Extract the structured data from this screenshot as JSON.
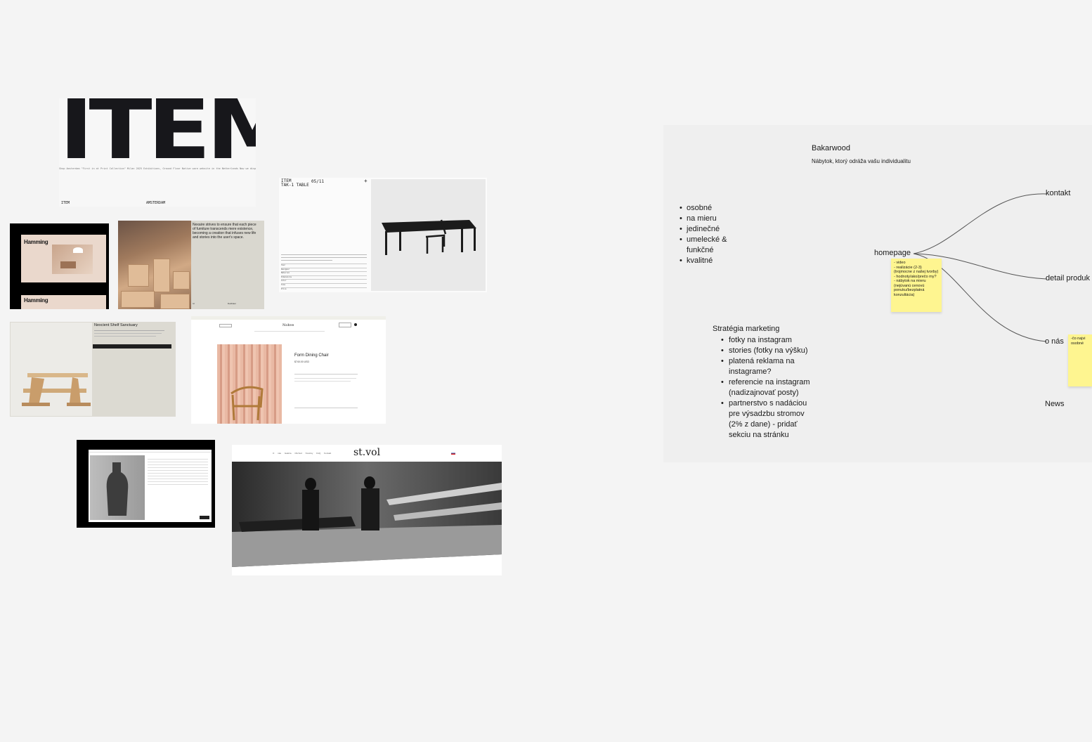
{
  "item_card": {
    "logo": "ITEM",
    "strip": "Shop Amsterdam     \"First in at Print Collection\" Milan 2025 Exhibitions, Ground Floor     Native ware website in the Netherlands     Now we display as sea Sheetroom by Eastwest Me",
    "footer_left": "ITEM",
    "footer_right": "AMSTERDAM"
  },
  "hamming": {
    "title_top": "Hamming",
    "title_bottom": "Hamming"
  },
  "wood_card": {
    "text": "Nexaire strives to ensure that each piece of furniture transcends mere existence, becoming a creation that infuses new life and stories into the user's space.",
    "footer_left": "Id",
    "footer_right": "Dekhaler"
  },
  "table_card": {
    "head": "ITEM\nTAK-1 TABLE",
    "number": "05/11",
    "plus": "+",
    "specs": [
      "Year",
      "Designer",
      "Material",
      "Dimensions",
      "Color",
      "Size",
      "Price"
    ]
  },
  "shelf_card": {
    "title": "Nexcient Shelf Sanctuary"
  },
  "chair_card": {
    "brand": "Nohve",
    "name": "Form Dining Chair",
    "price": "$740.00 USD"
  },
  "stvol_card": {
    "logo": "st.vol",
    "nav": "O nás Galéria Obchod Novinky FAQ Kontakt"
  },
  "mindmap": {
    "title": "Bakarwood",
    "subtitle": "Nábytok, ktorý odráža vašu individualitu",
    "bullets": [
      "osobné",
      "na mieru",
      "jedinečné",
      "umelecké & funkčné",
      "kvalitné"
    ],
    "strategy_title": "Stratégia marketing",
    "strategy": [
      "fotky na instagram",
      "stories (fotky na výšku)",
      "platená reklama na instagrame?",
      "referencie na instagram (nadizajnovať posty)",
      "partnerstvo s nadáciou pre výsadzbu stromov (2% z dane) - pridať sekciu na stránku"
    ],
    "nodes": {
      "homepage": "homepage",
      "kontakt": "kontakt",
      "detail": "detail produk",
      "onas": "o nás",
      "news": "News"
    },
    "sticky_home": "- video\n- realizácie (2-3) (trojmocne z našej tvorby)\n- hodnoty/ako/prečo my?\n- nábytok na mieru (nejúvanú cenovú ponuku/bezplatná konzultácia)",
    "sticky_onas": "-čo najvi\nosobné"
  },
  "colors": {
    "canvas": "#f4f4f4",
    "sticky": "#fef590",
    "panel": "#efefef"
  }
}
